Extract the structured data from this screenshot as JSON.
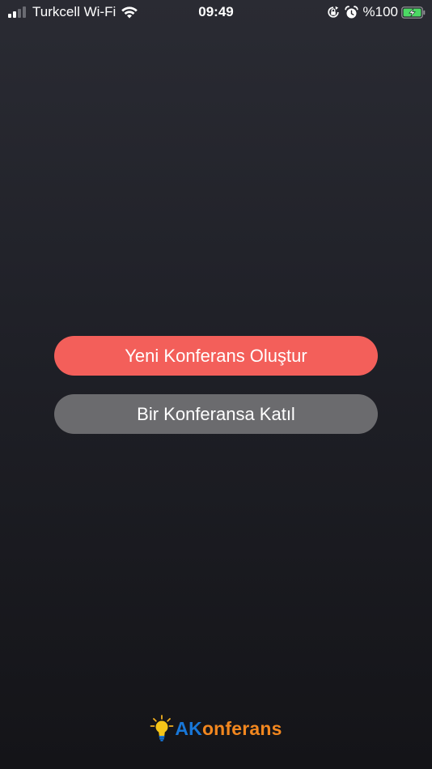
{
  "status_bar": {
    "carrier": "Turkcell Wi-Fi",
    "time": "09:49",
    "battery_percent": "%100",
    "icons": [
      "signal-icon",
      "wifi-icon",
      "orientation-lock-icon",
      "alarm-icon",
      "battery-charging-icon"
    ]
  },
  "buttons": {
    "create_label": "Yeni Konferans Oluştur",
    "join_label": "Bir Konferansa Katıl"
  },
  "logo": {
    "part1": "AK",
    "part2": "onferans"
  },
  "colors": {
    "primary_button": "#f35f5a",
    "secondary_button": "#6b6b6e",
    "logo_blue": "#1877d8",
    "logo_orange": "#f2871f",
    "battery_green": "#4cd964"
  }
}
